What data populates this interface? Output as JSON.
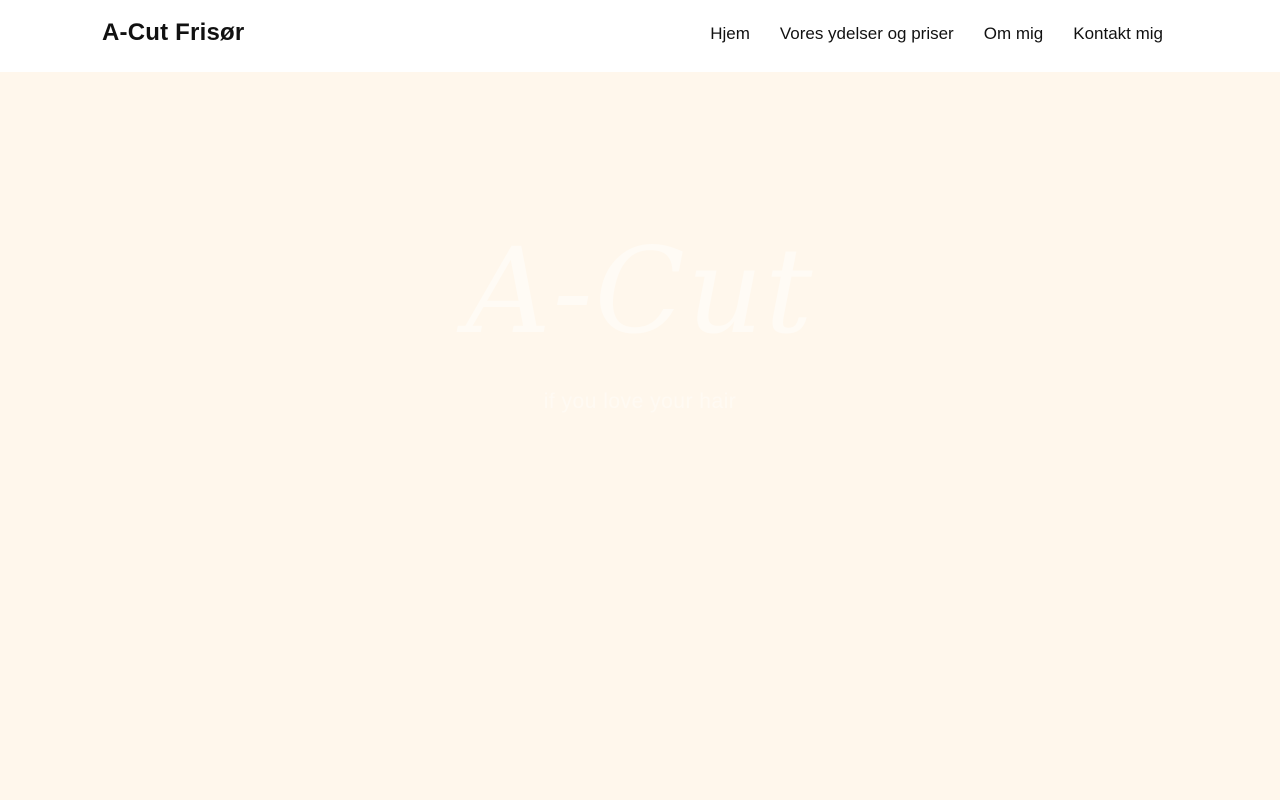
{
  "header": {
    "brand": "A-Cut Frisør",
    "nav": [
      {
        "label": "Hjem"
      },
      {
        "label": "Vores ydelser og priser"
      },
      {
        "label": "Om mig"
      },
      {
        "label": "Kontakt mig"
      }
    ]
  },
  "hero": {
    "script_title": "A-Cut",
    "tagline": "if you love your hair"
  },
  "colors": {
    "header_bg": "#ffffff",
    "hero_bg": "#fff7ec",
    "text": "#111111",
    "hero_text_faint": "#fffbf5"
  }
}
